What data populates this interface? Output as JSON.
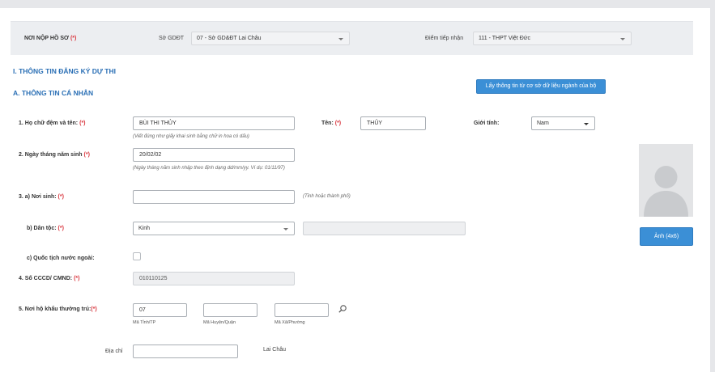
{
  "submission": {
    "place_label": "NƠI NỘP HỒ SƠ",
    "required_mark": "(*)",
    "department_label": "Sở GDĐT",
    "department_value": "07 - Sở GD&ĐT Lai Châu",
    "receive_label": "Điểm tiếp nhận",
    "receive_value": "111 - THPT Việt Đức"
  },
  "sections": {
    "registration": "I. THÔNG TIN ĐĂNG KÝ DỰ THI",
    "personal": "A. THÔNG TIN CÁ NHÂN"
  },
  "fetch_button": "Lấy thông tin từ cơ sở dữ liệu ngành của bộ",
  "form": {
    "full_name_label": "1. Họ chữ đệm và tên:",
    "full_name_value": "BÙI THI THỦY",
    "full_name_hint": "(Viết đúng như giấy khai sinh bằng chữ in hoa có dấu)",
    "first_name_label": "Tên:",
    "first_name_value": "THỦY",
    "gender_label": "Giới tính:",
    "gender_value": "Nam",
    "dob_label": "2. Ngày tháng năm sinh",
    "dob_value": "20/02/02",
    "dob_hint": "(Ngày tháng năm sinh nhập theo định dạng dd/mm/yy. Ví dụ: 01/11/97)",
    "birthplace_label": "3. a) Nơi sinh:",
    "birthplace_value": "",
    "birthplace_hint": "(Tỉnh hoặc thành phố)",
    "ethnicity_label": "b) Dân tộc:",
    "ethnicity_value": "Kinh",
    "foreign_label": "c) Quốc tịch nước ngoài:",
    "id_label": "4. Số CCCD/ CMND:",
    "id_value": "010110125",
    "residence_label": "5. Nơi hộ khẩu thường trú:",
    "province_code_value": "07",
    "province_code_label": "Mã Tỉnh/TP",
    "district_code_value": "",
    "district_code_label": "Mã Huyện/Quận",
    "ward_code_value": "",
    "ward_code_label": "Mã Xã/Phường",
    "address_label": "Địa chỉ",
    "address_value": "",
    "address_province_text": "Lai Châu"
  },
  "photo_button": "Ảnh (4x6)",
  "icons": {
    "search": "search-icon",
    "caret": "caret-down-icon",
    "avatar": "avatar-placeholder-icon"
  },
  "colors": {
    "primary": "#3b8fd6",
    "heading": "#2a6fb5",
    "required": "#d9363e"
  }
}
